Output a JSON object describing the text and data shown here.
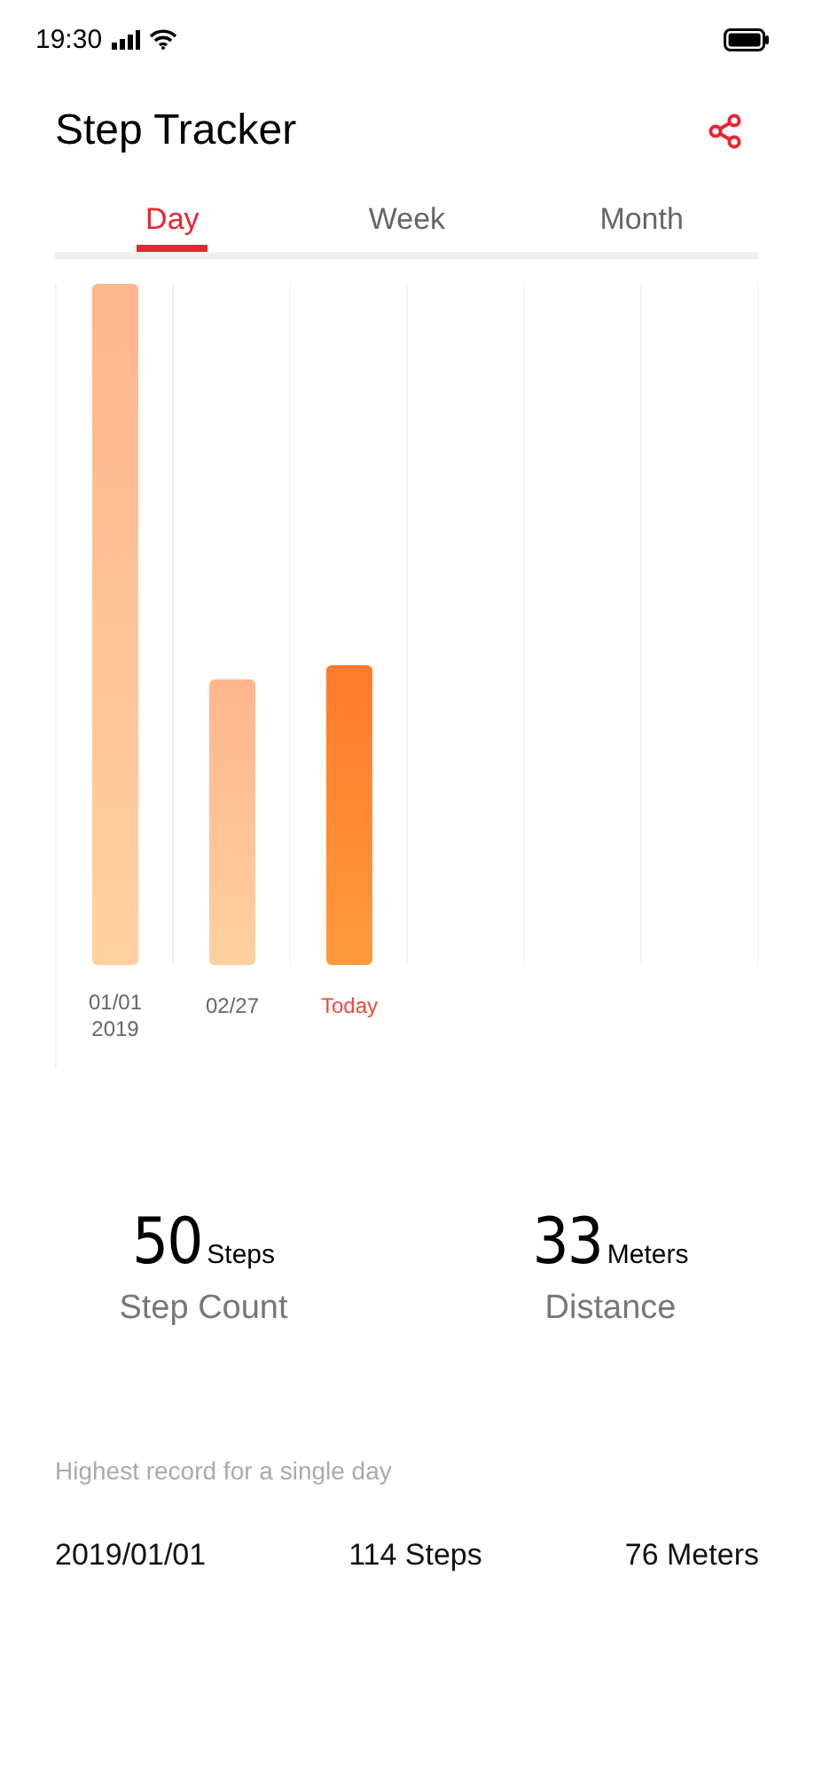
{
  "status_bar": {
    "time": "19:30"
  },
  "header": {
    "title": "Step Tracker"
  },
  "tabs": [
    {
      "label": "Day",
      "selected": true
    },
    {
      "label": "Week",
      "selected": false
    },
    {
      "label": "Month",
      "selected": false
    }
  ],
  "bars": [
    {
      "label": "01/01\n2019",
      "level": 1.0,
      "selected": false
    },
    {
      "label": "02/27",
      "level": 0.42,
      "selected": false
    },
    {
      "label": "Today",
      "level": 0.44,
      "selected": true
    }
  ],
  "stats": [
    {
      "value": "50",
      "unit": "Steps",
      "label": "Step Count"
    },
    {
      "value": "33",
      "unit": "Meters",
      "label": "Distance"
    }
  ],
  "record": {
    "heading": "Highest record for a single day",
    "date": "2019/01/01",
    "steps": "114 Steps",
    "distance": "76 Meters"
  }
}
